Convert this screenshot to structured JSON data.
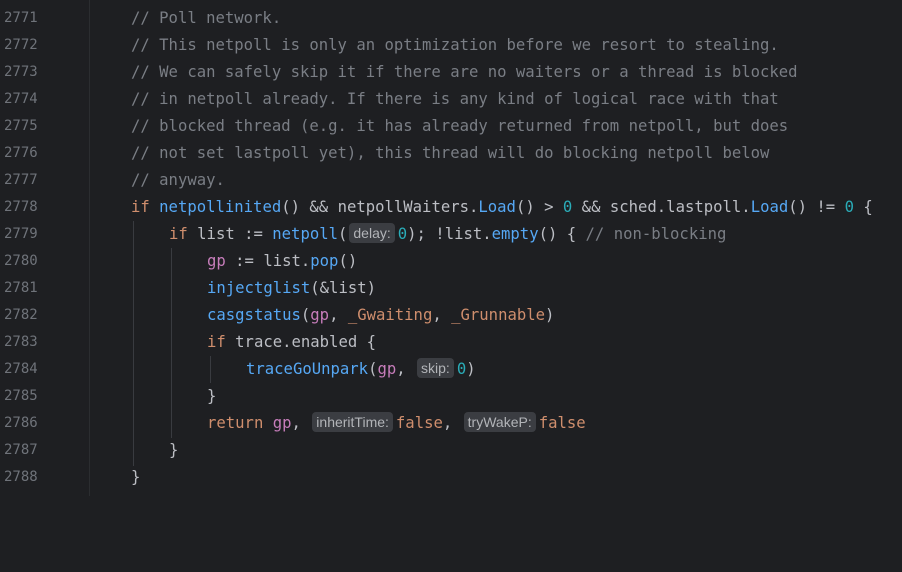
{
  "editor": {
    "line_numbers": [
      "2771",
      "2772",
      "2773",
      "2774",
      "2775",
      "2776",
      "2777",
      "2778",
      "2779",
      "2780",
      "2781",
      "2782",
      "2783",
      "2784",
      "2785",
      "2786",
      "2787",
      "2788"
    ],
    "comments": {
      "c2771": "// Poll network.",
      "c2772": "// This netpoll is only an optimization before we resort to stealing.",
      "c2773": "// We can safely skip it if there are no waiters or a thread is blocked",
      "c2774": "// in netpoll already. If there is any kind of logical race with that",
      "c2775": "// blocked thread (e.g. it has already returned from netpoll, but does",
      "c2776": "// not set lastpoll yet), this thread will do blocking netpoll below",
      "c2777": "// anyway."
    },
    "l2778": {
      "kw_if": "if",
      "fn1": "netpollinited",
      "t1": "() && netpollWaiters.",
      "fn2": "Load",
      "t2": "() > ",
      "num1": "0",
      "t3": " && sched.lastpoll.",
      "fn3": "Load",
      "t4": "() != ",
      "num2": "0",
      "t5": " {"
    },
    "l2779": {
      "kw_if": "if",
      "t1": " list := ",
      "fn1": "netpoll",
      "t2": "(",
      "hint": "delay:",
      "num1": "0",
      "t3": "); !list.",
      "fn2": "empty",
      "t4": "() { ",
      "comment": "// non-blocking"
    },
    "l2780": {
      "gp": "gp",
      "t1": " := list.",
      "fn1": "pop",
      "t2": "()"
    },
    "l2781": {
      "fn1": "injectglist",
      "t1": "(&list)"
    },
    "l2782": {
      "fn1": "casgstatus",
      "t1": "(",
      "gp": "gp",
      "t2": ", ",
      "c1": "_Gwaiting",
      "t3": ", ",
      "c2": "_Grunnable",
      "t4": ")"
    },
    "l2783": {
      "kw_if": "if",
      "t1": " trace.enabled {"
    },
    "l2784": {
      "fn1": "traceGoUnpark",
      "t1": "(",
      "gp": "gp",
      "t2": ", ",
      "hint": "skip:",
      "num1": "0",
      "t3": ")"
    },
    "l2785": {
      "t1": "}"
    },
    "l2786": {
      "kw_return": "return",
      "t1": " ",
      "gp": "gp",
      "t2": ", ",
      "hint1": "inheritTime:",
      "v1": "false",
      "t3": ", ",
      "hint2": "tryWakeP:",
      "v2": "false"
    },
    "l2787": {
      "t1": "}"
    },
    "l2788": {
      "t1": "}"
    }
  },
  "colors": {
    "background": "#1e1f22",
    "comment": "#7a7e85",
    "keyword": "#cf8e6d",
    "function": "#56a8f5",
    "number": "#2aacb8",
    "parameter": "#c77dbb",
    "text": "#bcbec4",
    "line_number": "#6f737a",
    "inlay_hint_bg": "#3b3d42"
  }
}
